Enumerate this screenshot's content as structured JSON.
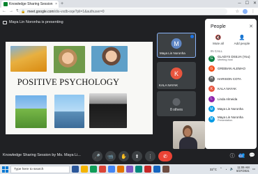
{
  "browser": {
    "tab_title": "Knowledge Sharing Session",
    "tab_close": "×",
    "new_tab": "+",
    "window_controls": [
      "─",
      "☐",
      "✕"
    ],
    "url_host": "meet.google.com",
    "url_path": "/dis-vxdb-oqe?pli=1&authuser=0",
    "nav": [
      "←",
      "→",
      "↻"
    ]
  },
  "meet": {
    "presenting_label": "Maya Lin Noronha is presenting",
    "slide_title": "POSITIVE PSYCHOLOGY",
    "tiles": [
      {
        "initial": "M",
        "name": "Maya Lin Noronha"
      },
      {
        "initial": "K",
        "name": "KALA NAYAK"
      }
    ],
    "others_text": "8 others",
    "bottom_title": "Knowledge Sharing Session by Ms. Maya Li...",
    "controls": [
      "🎤",
      "📹",
      "✋",
      "⬆",
      "⋮",
      "✆"
    ],
    "right_icons": [
      "ⓘ",
      "👥",
      "💬"
    ],
    "participant_count": "10"
  },
  "people_panel": {
    "title": "People",
    "close": "✕",
    "mute_all": "Mute all",
    "add_people": "Add people",
    "in_meeting_label": "IN CALL",
    "participants": [
      {
        "initial": "G",
        "name": "GLADYS DSILVA (You)",
        "role": "Meeting host",
        "color": "#0b8043"
      },
      {
        "initial": "G",
        "name": "GREBIAN ALEMAO",
        "role": "",
        "color": "#f4511e"
      },
      {
        "initial": "H",
        "name": "HARISON COTA",
        "role": "",
        "color": "#616161"
      },
      {
        "initial": "K",
        "name": "KALA NAYAK",
        "role": "",
        "color": "#e8553e"
      },
      {
        "initial": "L",
        "name": "Linda Almeida",
        "role": "",
        "color": "#8e24aa"
      },
      {
        "initial": "M",
        "name": "Maya Lin Noronha",
        "role": "",
        "color": "#039be5"
      },
      {
        "initial": "M",
        "name": "Maya Lin Noronha",
        "role": "Presentation",
        "color": "#039be5"
      }
    ]
  },
  "taskbar": {
    "search_placeholder": "Type here to search",
    "app_colors": [
      "#2b579a",
      "#f4b400",
      "#0f9d58",
      "#db4437",
      "#4285f4",
      "#e37400",
      "#7e57c2",
      "#00897b",
      "#c62828",
      "#1565c0",
      "#6d4c41"
    ],
    "temperature": "32°C",
    "time": "11:09 AM",
    "date": "8/27/2021"
  }
}
